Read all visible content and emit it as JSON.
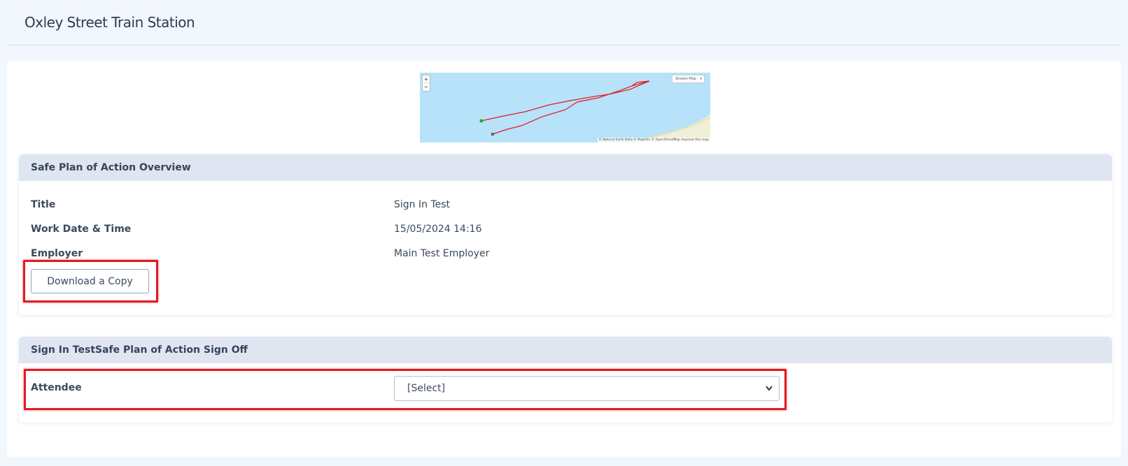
{
  "page": {
    "title": "Oxley Street Train Station"
  },
  "map": {
    "zoom_in": "+",
    "zoom_out": "−",
    "layer_select": "Streets Map",
    "attribution": "© Natural Earth Data © Maptiler © OpenStreetMap Improve this map",
    "route_color": "#e01b24",
    "water_color": "#b7e2fa",
    "land_color": "#f0efd8"
  },
  "overview": {
    "heading": "Safe Plan of Action Overview",
    "fields": [
      {
        "label": "Title",
        "value": "Sign In Test"
      },
      {
        "label": "Work Date & Time",
        "value": "15/05/2024 14:16"
      },
      {
        "label": "Employer",
        "value": "Main Test Employer"
      }
    ],
    "download_label": "Download a Copy"
  },
  "signoff": {
    "heading": "Sign In TestSafe Plan of Action Sign Off",
    "attendee_label": "Attendee",
    "attendee_selected": "[Select]"
  },
  "colors": {
    "highlight": "#e01b24",
    "panel_header_bg": "#dfe6f2",
    "page_bg": "#f2f6fd"
  }
}
